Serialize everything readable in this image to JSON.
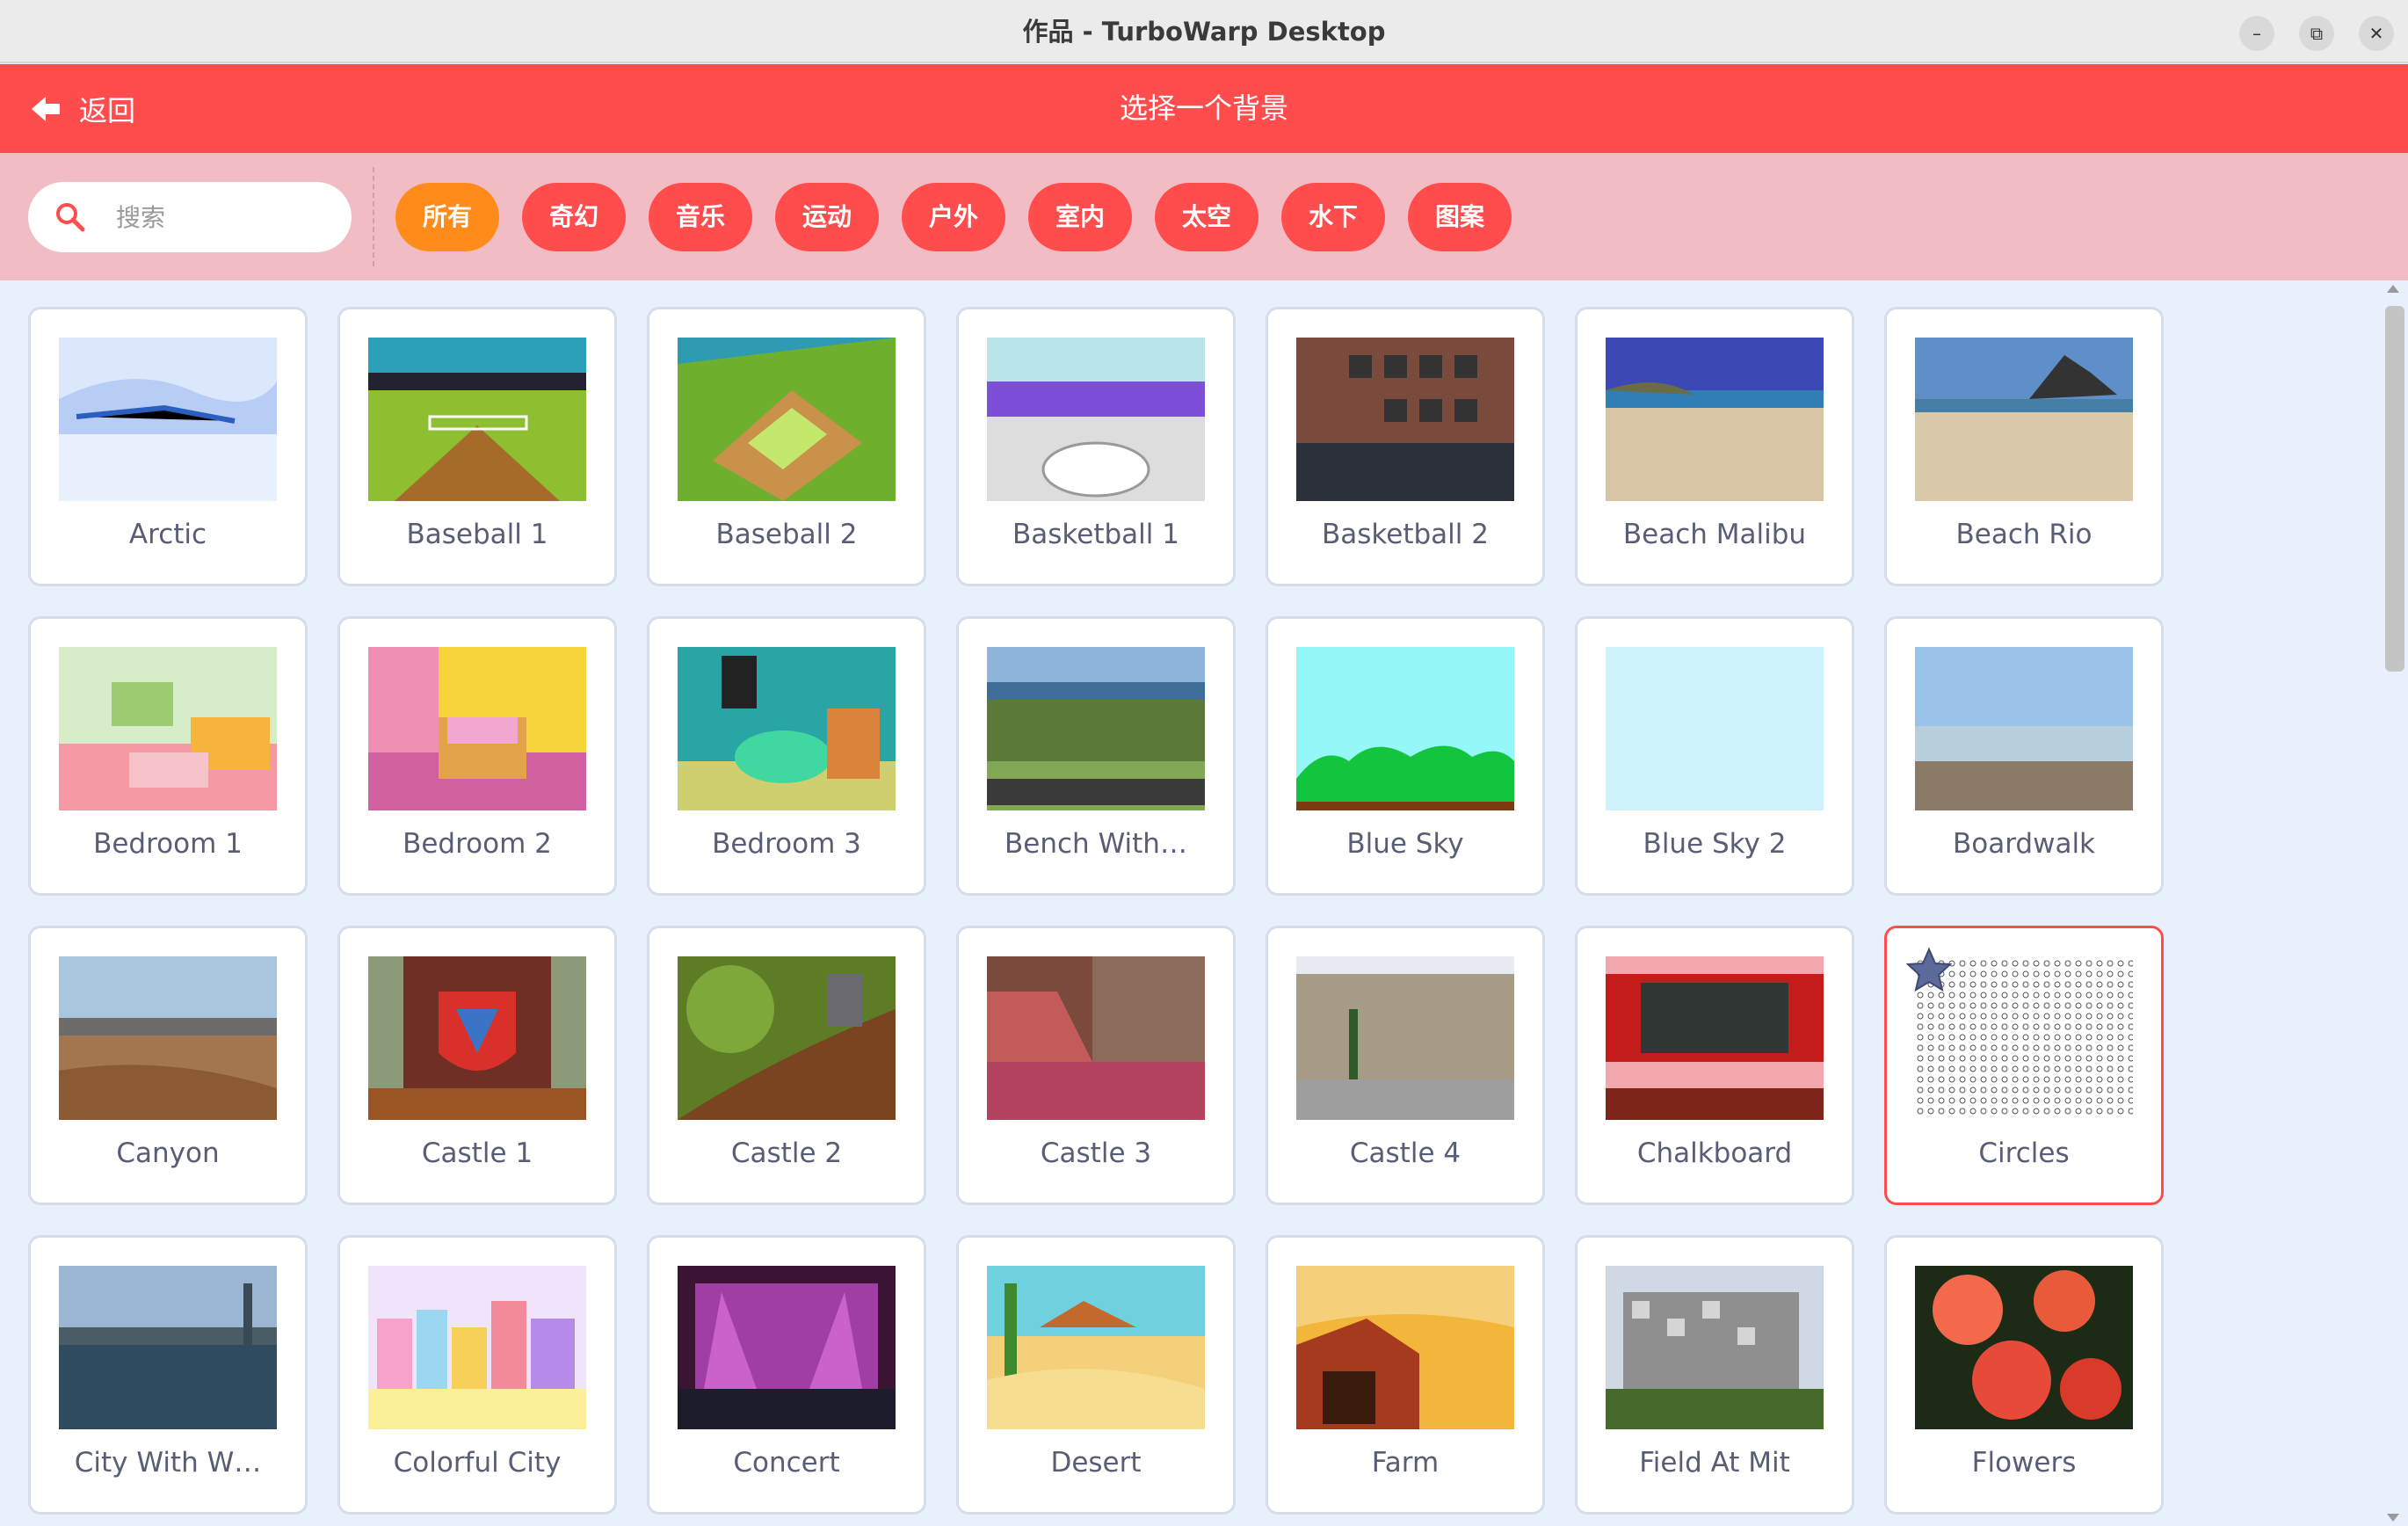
{
  "window": {
    "title": "作品 - TurboWarp Desktop",
    "minimize_glyph": "–",
    "maximize_glyph": "⧉",
    "close_glyph": "✕"
  },
  "header": {
    "back_label": "返回",
    "heading": "选择一个背景"
  },
  "search": {
    "placeholder": "搜索",
    "value": ""
  },
  "tags": [
    {
      "label": "所有",
      "active": true
    },
    {
      "label": "奇幻",
      "active": false
    },
    {
      "label": "音乐",
      "active": false
    },
    {
      "label": "运动",
      "active": false
    },
    {
      "label": "户外",
      "active": false
    },
    {
      "label": "室内",
      "active": false
    },
    {
      "label": "太空",
      "active": false
    },
    {
      "label": "水下",
      "active": false
    },
    {
      "label": "图案",
      "active": false
    }
  ],
  "backdrops": [
    {
      "name": "Arctic",
      "selected": false
    },
    {
      "name": "Baseball 1",
      "selected": false
    },
    {
      "name": "Baseball 2",
      "selected": false
    },
    {
      "name": "Basketball 1",
      "selected": false
    },
    {
      "name": "Basketball 2",
      "selected": false
    },
    {
      "name": "Beach Malibu",
      "selected": false
    },
    {
      "name": "Beach Rio",
      "selected": false
    },
    {
      "name": "Bedroom 1",
      "selected": false
    },
    {
      "name": "Bedroom 2",
      "selected": false
    },
    {
      "name": "Bedroom 3",
      "selected": false
    },
    {
      "name": "Bench With…",
      "selected": false
    },
    {
      "name": "Blue Sky",
      "selected": false
    },
    {
      "name": "Blue Sky 2",
      "selected": false
    },
    {
      "name": "Boardwalk",
      "selected": false
    },
    {
      "name": "Canyon",
      "selected": false
    },
    {
      "name": "Castle 1",
      "selected": false
    },
    {
      "name": "Castle 2",
      "selected": false
    },
    {
      "name": "Castle 3",
      "selected": false
    },
    {
      "name": "Castle 4",
      "selected": false
    },
    {
      "name": "Chalkboard",
      "selected": false
    },
    {
      "name": "Circles",
      "selected": true
    },
    {
      "name": "City With W…",
      "selected": false
    },
    {
      "name": "Colorful City",
      "selected": false
    },
    {
      "name": "Concert",
      "selected": false
    },
    {
      "name": "Desert",
      "selected": false
    },
    {
      "name": "Farm",
      "selected": false
    },
    {
      "name": "Field At Mit",
      "selected": false
    },
    {
      "name": "Flowers",
      "selected": false
    }
  ],
  "colors": {
    "brand": "#ff4d4d",
    "active_tag": "#ff8c1a",
    "filter_bar": "#f2bcc4",
    "grid_bg": "#e8f0fb"
  },
  "icons": {
    "back": "arrow-left-icon",
    "search": "search-icon",
    "favorite": "star-icon"
  }
}
